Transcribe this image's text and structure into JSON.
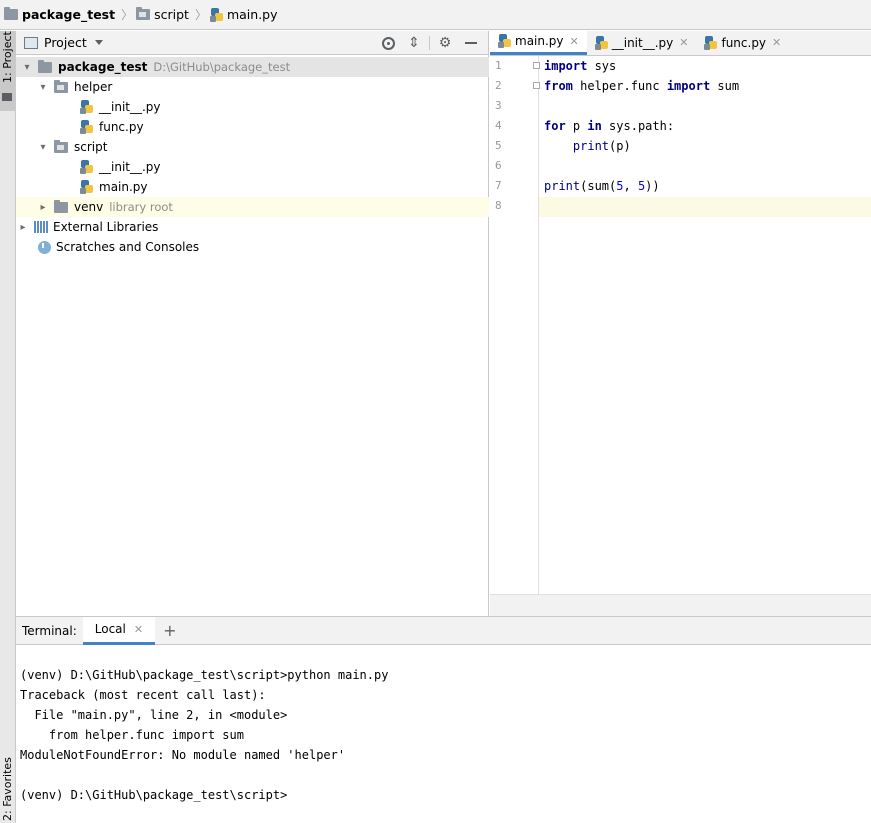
{
  "navbar": {
    "crumbs": [
      {
        "label": "package_test"
      },
      {
        "label": "script"
      },
      {
        "label": "main.py"
      }
    ]
  },
  "left_strip": {
    "project_label": "1: Project",
    "favorites_label": "2: Favorites"
  },
  "project_panel": {
    "title": "Project",
    "tree": [
      {
        "name": "package_test",
        "path": "D:\\GitHub\\package_test"
      },
      {
        "name": "helper"
      },
      {
        "name": "__init__.py"
      },
      {
        "name": "func.py"
      },
      {
        "name": "script"
      },
      {
        "name": "__init__.py"
      },
      {
        "name": "main.py"
      },
      {
        "name": "venv",
        "note": "library root"
      },
      {
        "name": "External Libraries"
      },
      {
        "name": "Scratches and Consoles"
      }
    ]
  },
  "editor": {
    "tabs": [
      {
        "label": "main.py",
        "active": true
      },
      {
        "label": "__init__.py",
        "active": false
      },
      {
        "label": "func.py",
        "active": false
      }
    ],
    "line_numbers": [
      "1",
      "2",
      "3",
      "4",
      "5",
      "6",
      "7",
      "8"
    ],
    "code": [
      {
        "parts": [
          {
            "t": "import",
            "c": "kw"
          },
          {
            "t": " sys",
            "c": ""
          }
        ]
      },
      {
        "parts": [
          {
            "t": "from",
            "c": "kw"
          },
          {
            "t": " helper.func ",
            "c": ""
          },
          {
            "t": "import",
            "c": "kw"
          },
          {
            "t": " sum",
            "c": ""
          }
        ]
      },
      {
        "parts": []
      },
      {
        "parts": [
          {
            "t": "for",
            "c": "kw"
          },
          {
            "t": " p ",
            "c": ""
          },
          {
            "t": "in",
            "c": "kw"
          },
          {
            "t": " sys.path:",
            "c": ""
          }
        ]
      },
      {
        "parts": [
          {
            "t": "    ",
            "c": ""
          },
          {
            "t": "print",
            "c": "fn"
          },
          {
            "t": "(p)",
            "c": ""
          }
        ]
      },
      {
        "parts": []
      },
      {
        "parts": [
          {
            "t": "print",
            "c": "fn"
          },
          {
            "t": "(sum(",
            "c": ""
          },
          {
            "t": "5",
            "c": "num"
          },
          {
            "t": ", ",
            "c": ""
          },
          {
            "t": "5",
            "c": "num"
          },
          {
            "t": "))",
            "c": ""
          }
        ]
      },
      {
        "parts": []
      }
    ]
  },
  "terminal": {
    "title": "Terminal:",
    "tab_label": "Local",
    "add_label": "+",
    "lines": [
      "",
      "(venv) D:\\GitHub\\package_test\\script>python main.py",
      "Traceback (most recent call last):",
      "  File \"main.py\", line 2, in <module>",
      "    from helper.func import sum",
      "ModuleNotFoundError: No module named 'helper'",
      "",
      "(venv) D:\\GitHub\\package_test\\script>"
    ]
  },
  "colors": {
    "keyword": "#000080",
    "number": "#0000ff",
    "tab_underline": "#4083c9",
    "current_line": "#fcfae3",
    "library_root_bg": "#fefde5"
  }
}
